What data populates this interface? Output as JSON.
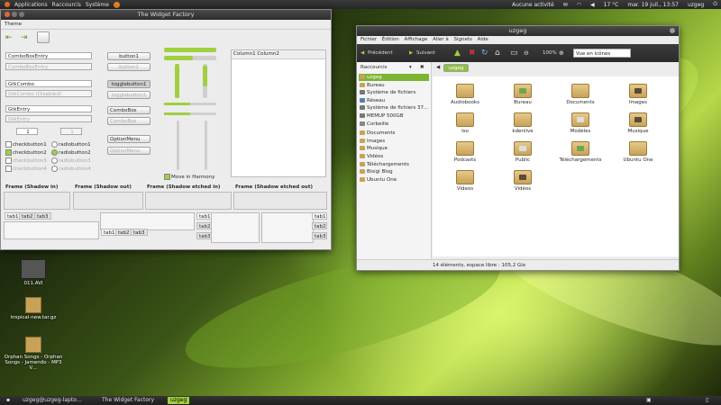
{
  "topbar": {
    "menus": [
      "Applications",
      "Raccourcis",
      "Système"
    ],
    "activity": "Aucune activité",
    "temperature": "17 °C",
    "clock": "mar. 19 juil., 13:57",
    "user": "uzgeg"
  },
  "taskbar": {
    "items": [
      "uzgeg@uzgeg-lapto…",
      "The Widget Factory",
      "uzgeg"
    ]
  },
  "widget_factory": {
    "title": "The Widget Factory",
    "menu": "Theme",
    "combo_entry": "ComboBoxEntry",
    "combo_entry_dis": "ComboBoxEntry",
    "gtkcombo": "GtkCombo",
    "gtkcombo_dis": "GtkCombo (Disabled)",
    "gtkentry": "GtkEntry",
    "gtkentry_dis": "GtkEntry",
    "spin1": "1",
    "spin2": "1",
    "button1": "button1",
    "button1_dis": "button1",
    "toggle1": "togglebutton1",
    "toggle1_dis": "togglebutton1",
    "combobox": "ComboBox",
    "combobox_dis": "ComboBox",
    "optionmenu": "OptionMenu",
    "optionmenu_dis": "OptionMenu",
    "check1": "checkbutton1",
    "check2": "checkbutton2",
    "check3": "checkbutton3",
    "check4": "checkbutton4",
    "radio1": "radiobutton1",
    "radio2": "radiobutton2",
    "radio3": "radiobutton3",
    "radio4": "radiobutton4",
    "move_harmony": "Move in Harmony",
    "col1": "Column1",
    "col2": "Column2",
    "frames": [
      "Frame (Shadow in)",
      "Frame (Shadow out)",
      "Frame (Shadow etched in)",
      "Frame (Shadow etched out)"
    ],
    "tabs": [
      "tab1",
      "tab2",
      "tab3"
    ]
  },
  "nautilus": {
    "title": "uzgeg",
    "menu": [
      "Fichier",
      "Édition",
      "Affichage",
      "Aller à",
      "Signets",
      "Aide"
    ],
    "back": "Précédent",
    "forward": "Suivant",
    "zoom": "100%",
    "view_mode": "Vue en icônes",
    "sidebar_title": "Raccourcis",
    "path_button": "uzgeg",
    "sidebar": [
      {
        "label": "uzgeg",
        "color": "#c9a25a"
      },
      {
        "label": "Bureau",
        "color": "#c9a25a"
      },
      {
        "label": "Système de fichiers",
        "color": "#777"
      },
      {
        "label": "Réseau",
        "color": "#5a7fb0"
      },
      {
        "label": "Système de fichiers 37…",
        "color": "#777"
      },
      {
        "label": "MEMUP 500GB",
        "color": "#777"
      },
      {
        "label": "Corbeille",
        "color": "#888"
      },
      {
        "label": "Documents",
        "color": "#c9a25a"
      },
      {
        "label": "Images",
        "color": "#c9a25a"
      },
      {
        "label": "Musique",
        "color": "#c9a25a"
      },
      {
        "label": "Vidéos",
        "color": "#c9a25a"
      },
      {
        "label": "Téléchargements",
        "color": "#c9a25a"
      },
      {
        "label": "Bisigi Blog",
        "color": "#c9a25a"
      },
      {
        "label": "Ubuntu One",
        "color": "#c9a25a"
      }
    ],
    "files": [
      {
        "label": "Audiobooks",
        "emblem": ""
      },
      {
        "label": "Bureau",
        "emblem": "#6aa84f"
      },
      {
        "label": "Documents",
        "emblem": ""
      },
      {
        "label": "Images",
        "emblem": "#5a4a3a"
      },
      {
        "label": "Iso",
        "emblem": ""
      },
      {
        "label": "kdenlive",
        "emblem": ""
      },
      {
        "label": "Modèles",
        "emblem": "#dddddd"
      },
      {
        "label": "Musique",
        "emblem": "#5a4a3a"
      },
      {
        "label": "Podcasts",
        "emblem": ""
      },
      {
        "label": "Public",
        "emblem": "#dddddd"
      },
      {
        "label": "Téléchargements",
        "emblem": "#6aa84f"
      },
      {
        "label": "Ubuntu One",
        "emblem": ""
      },
      {
        "label": "Videos",
        "emblem": ""
      },
      {
        "label": "Vidéos",
        "emblem": "#5a4a3a"
      }
    ],
    "status": "14 éléments, espace libre : 105,2 Gio"
  },
  "desktop": {
    "icons": [
      "011.AVI",
      "tropical-new.tar.gz",
      "Orphan Songs - Orphan Songs - Jamendo - MP3 V…"
    ]
  }
}
